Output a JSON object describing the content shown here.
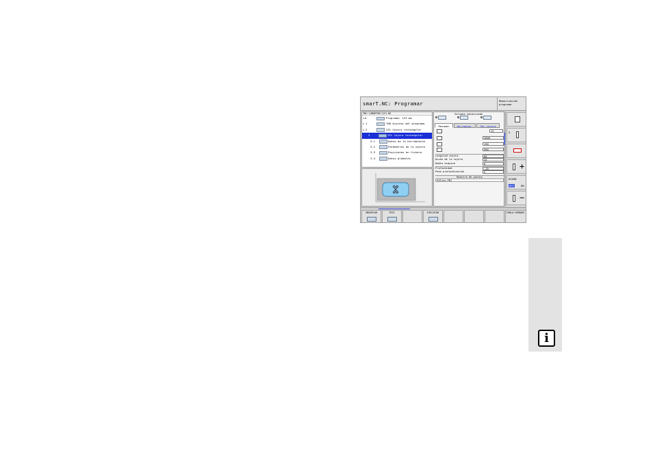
{
  "header": {
    "title": "smarT.NC: Programar",
    "mode_line1": "Memorización",
    "mode_line2": "programa"
  },
  "tree": {
    "path": "TNC:\\SMARTNC\\123.HU",
    "rows": [
      {
        "bullet": "▫",
        "num": "0",
        "label": "Programa: 123 mm"
      },
      {
        "bullet": "▫",
        "num": "1",
        "label": "700 Ajustes del programa"
      },
      {
        "bullet": "▫",
        "num": "2",
        "label": "251 Cajera rectangular"
      },
      {
        "bullet": "",
        "num": "3",
        "label": "251 Cajera rectangular"
      },
      {
        "bullet": "",
        "num": "3.1",
        "label": "Datos de la herramienta"
      },
      {
        "bullet": "",
        "num": "3.2",
        "label": "Parámetros de la cajera"
      },
      {
        "bullet": "",
        "num": "3.3",
        "label": "Posiciones en fichero"
      },
      {
        "bullet": "",
        "num": "3.4",
        "label": "Datos globales"
      }
    ]
  },
  "form": {
    "volume_title": "Volumen mecanizado",
    "tabs": [
      "Resumen",
      "Herramien.",
      "Par.cajera"
    ],
    "tool_value": "12",
    "s_value": "3000",
    "f1_value": "150",
    "f2_value": "500",
    "fields": [
      {
        "label": "Longitud cajera",
        "value": "60"
      },
      {
        "label": "Ancho de la cajera",
        "value": "20"
      },
      {
        "label": "Radio esquina",
        "value": "0"
      },
      {
        "label": "Profundidad",
        "value": "-20"
      },
      {
        "label": "Paso profundización",
        "value": "5"
      }
    ],
    "pattern_title": "Muestra de puntos",
    "pattern_value": "PATxxx.PNT"
  },
  "side": {
    "s_label": "S",
    "diag_label": "DIAGN",
    "off_label": "OFF",
    "on_label": "ON"
  },
  "bottom": {
    "keys": [
      "INSERTAR",
      "TEST",
      "",
      "EJECUTAR",
      "",
      "",
      "",
      "TABLA HERRAM."
    ]
  },
  "info": {
    "glyph": "i"
  },
  "colors": {
    "selection": "#1a2fd6",
    "panel": "#d0d0d0"
  }
}
